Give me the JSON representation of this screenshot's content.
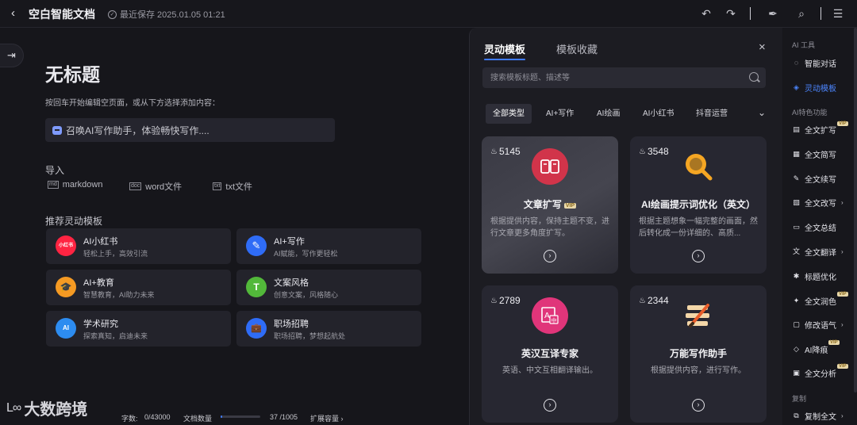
{
  "topbar": {
    "back_icon": "chevron-left-icon",
    "doc_title": "空白智能文档",
    "save_status": "最近保存 2025.01.05 01:21",
    "undo_icon": "undo-icon",
    "redo_icon": "redo-icon",
    "pen_icon": "pen-icon",
    "find_icon": "find-replace-icon",
    "menu_icon": "hamburger-menu-icon"
  },
  "editor": {
    "title": "无标题",
    "hint": "按回车开始编辑空页面，或从下方选择添加内容：",
    "ai_prompt": "召唤AI写作助手，体验畅快写作....",
    "import_title": "导入",
    "import_items": [
      {
        "icon": "md",
        "label": "markdown"
      },
      {
        "icon": "doc",
        "label": "word文件"
      },
      {
        "icon": "txt",
        "label": "txt文件"
      }
    ],
    "recommend_title": "推荐灵动模板",
    "templates": [
      {
        "name": "AI小红书",
        "desc": "轻松上手，高效引流",
        "icon": "小红书",
        "color": "#ff2442"
      },
      {
        "name": "AI+写作",
        "desc": "AI赋能，写作更轻松",
        "icon": "✎",
        "color": "#2f6cf6"
      },
      {
        "name": "AI+教育",
        "desc": "智慧教育，AI助力未来",
        "icon": "🎓",
        "color": "#f59a23"
      },
      {
        "name": "文案风格",
        "desc": "创意文案，风格随心",
        "icon": "T",
        "color": "#52b83a"
      },
      {
        "name": "学术研究",
        "desc": "探索真知，启迪未来",
        "icon": "AI",
        "color": "#2d8cf0"
      },
      {
        "name": "职场招聘",
        "desc": "职场招聘，梦想起航处",
        "icon": "💼",
        "color": "#2f6cf6"
      }
    ]
  },
  "bottombar": {
    "logo_mark": "L∞",
    "logo_text": "大数跨境",
    "word_count_label": "字数:",
    "word_count": "0/43000",
    "doc_count_label": "文档数量",
    "doc_count": "37 /1005",
    "doc_progress": 0.037,
    "expand_label": "扩展容量 ›"
  },
  "panel": {
    "tabs": [
      "灵动模板",
      "模板收藏"
    ],
    "active_tab": 0,
    "close_icon": "close-icon",
    "search_placeholder": "搜索模板标题、描述等",
    "categories": [
      "全部类型",
      "AI+写作",
      "AI绘画",
      "AI小红书",
      "抖音运营"
    ],
    "active_category": 0,
    "more_icon": "double-chevron-down-icon",
    "cards": [
      {
        "heat": "5145",
        "name": "文章扩写",
        "vip": "VIP",
        "desc": "根据提供内容，保持主题不变，进行文章更多角度扩写。",
        "icon_color": "#d1344a"
      },
      {
        "heat": "3548",
        "name": "AI绘画提示词优化（英文）",
        "vip": "",
        "desc": "根据主题想象一幅完整的画面，然后转化成一份详细的、高质...",
        "icon_color": "#f5a623"
      },
      {
        "heat": "2789",
        "name": "英汉互译专家",
        "vip": "",
        "desc": "英语、中文互相翻译输出。",
        "icon_color": "#e0357a"
      },
      {
        "heat": "2344",
        "name": "万能写作助手",
        "vip": "",
        "desc": "根据提供内容，进行写作。",
        "icon_color": "#e85d2a"
      }
    ]
  },
  "rail": {
    "group1": "AI 工具",
    "group2": "AI特色功能",
    "group3": "复制",
    "items": [
      {
        "label": "智能对话",
        "icon": "chat-icon"
      },
      {
        "label": "灵动模板",
        "icon": "template-icon"
      },
      {
        "label": "全文扩写",
        "icon": "expand-icon",
        "vip": "VIP"
      },
      {
        "label": "全文简写",
        "icon": "shorten-icon"
      },
      {
        "label": "全文续写",
        "icon": "continue-icon"
      },
      {
        "label": "全文改写",
        "icon": "rewrite-icon",
        "arrow": "›"
      },
      {
        "label": "全文总结",
        "icon": "summary-icon"
      },
      {
        "label": "全文翻译",
        "icon": "translate-icon",
        "arrow": "›"
      },
      {
        "label": "标题优化",
        "icon": "title-icon"
      },
      {
        "label": "全文润色",
        "icon": "polish-icon",
        "vip": "VIP"
      },
      {
        "label": "修改语气",
        "icon": "tone-icon",
        "arrow": "›"
      },
      {
        "label": "AI降痕",
        "icon": "eraser-icon",
        "vip": "VIP"
      },
      {
        "label": "全文分析",
        "icon": "analysis-icon",
        "vip": "VIP"
      },
      {
        "label": "复制全文",
        "icon": "copy-icon",
        "arrow": "›"
      }
    ]
  }
}
